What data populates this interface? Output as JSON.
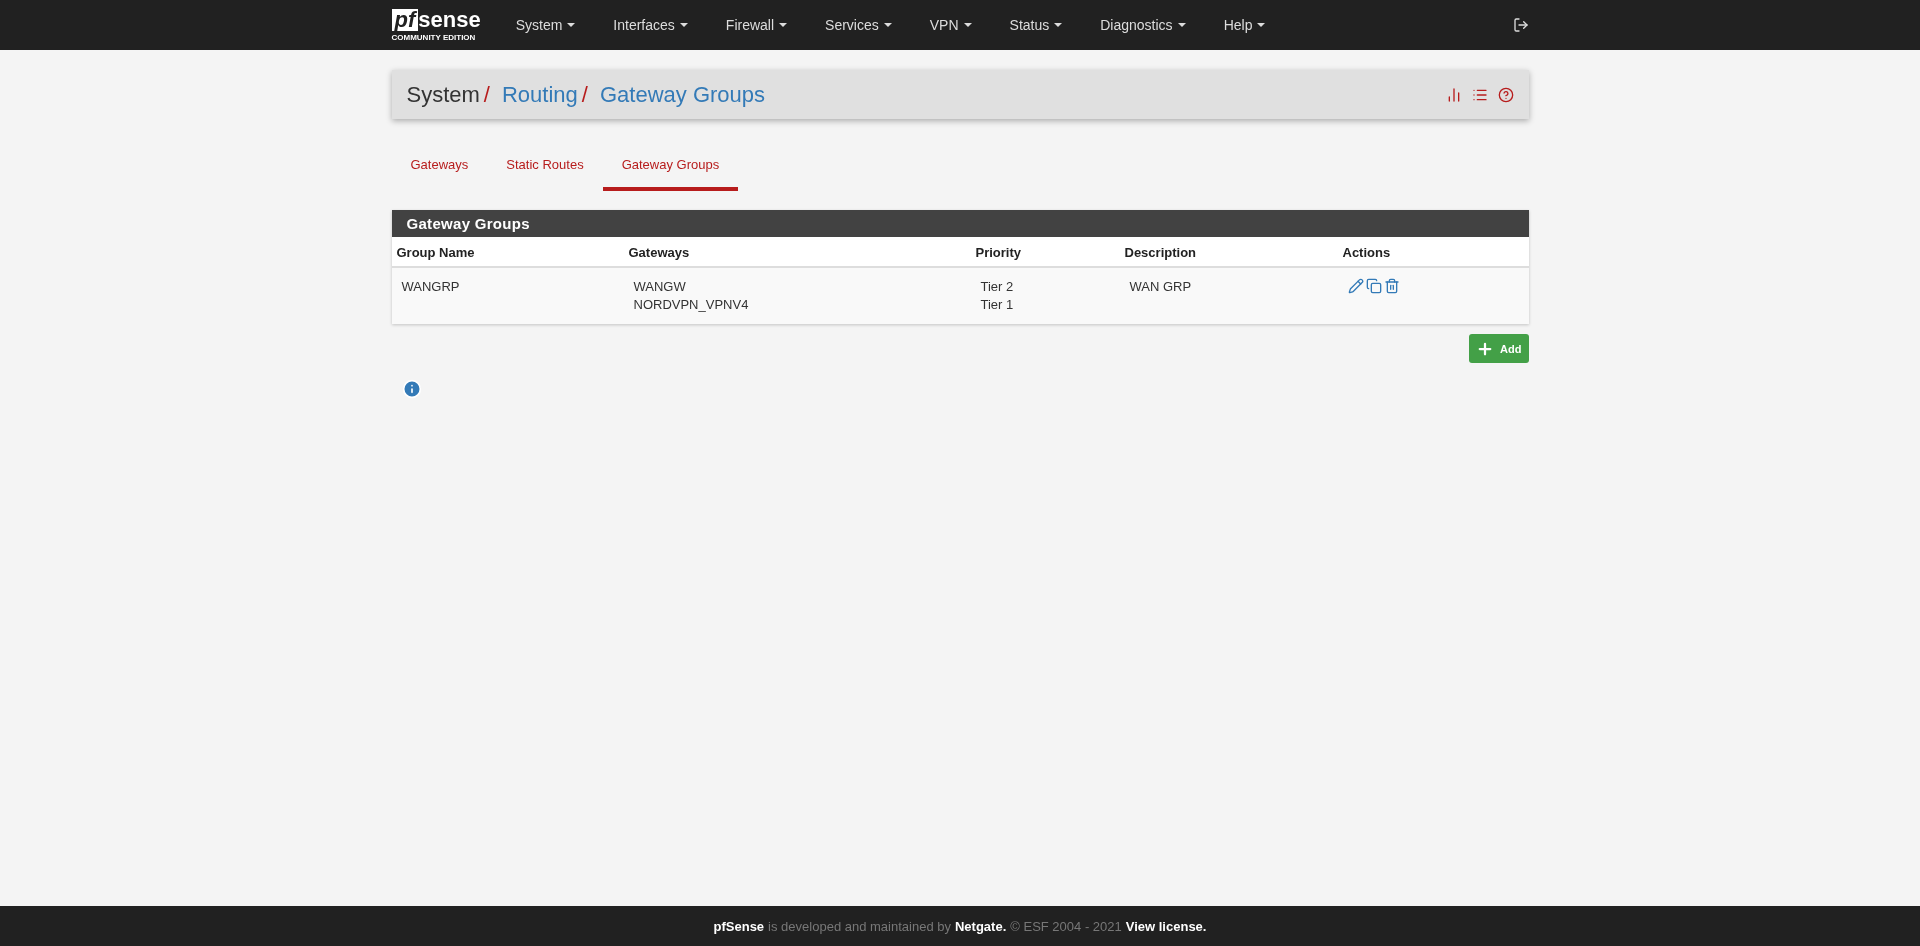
{
  "logo": {
    "mark": "pf",
    "word": "sense",
    "edition": "COMMUNITY EDITION"
  },
  "menu": [
    {
      "label": "System"
    },
    {
      "label": "Interfaces"
    },
    {
      "label": "Firewall"
    },
    {
      "label": "Services"
    },
    {
      "label": "VPN"
    },
    {
      "label": "Status"
    },
    {
      "label": "Diagnostics"
    },
    {
      "label": "Help"
    }
  ],
  "breadcrumb": [
    {
      "label": "System",
      "kind": "plain",
      "separator": "/"
    },
    {
      "label": "Routing",
      "kind": "link",
      "separator": "/"
    },
    {
      "label": "Gateway Groups",
      "kind": "link"
    }
  ],
  "tabs": [
    {
      "label": "Gateways",
      "selected": false
    },
    {
      "label": "Static Routes",
      "selected": false
    },
    {
      "label": "Gateway Groups",
      "selected": true
    }
  ],
  "panel": {
    "title": "Gateway Groups",
    "columns": [
      "Group Name",
      "Gateways",
      "Priority",
      "Description",
      "Actions"
    ],
    "rows": [
      {
        "name": "WANGRP",
        "gateways": [
          "WANGW",
          "NORDVPN_VPNV4"
        ],
        "priorities": [
          "Tier 2",
          "Tier 1"
        ],
        "description": "WAN GRP"
      }
    ]
  },
  "add_button": "Add",
  "footer": [
    {
      "text": "pfSense",
      "kind": "bold"
    },
    {
      "text": "is developed and maintained by",
      "kind": "plain"
    },
    {
      "text": "Netgate.",
      "kind": "link"
    },
    {
      "text": "© ESF 2004 - 2021",
      "kind": "plain"
    },
    {
      "text": "View license.",
      "kind": "link"
    }
  ]
}
